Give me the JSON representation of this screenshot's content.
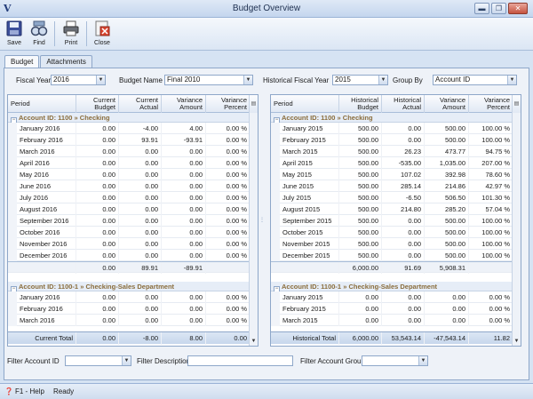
{
  "window": {
    "title": "Budget Overview",
    "app_glyph": "V"
  },
  "toolbar": {
    "save": "Save",
    "find": "Find",
    "print": "Print",
    "close": "Close"
  },
  "tabs": [
    {
      "label": "Budget"
    },
    {
      "label": "Attachments"
    }
  ],
  "filters": {
    "fiscal_year_label": "Fiscal Year",
    "fiscal_year_value": "2016",
    "budget_name_label": "Budget Name",
    "budget_name_value": "Final 2010",
    "hist_year_label": "Historical Fiscal Year",
    "hist_year_value": "2015",
    "group_by_label": "Group By",
    "group_by_value": "Account ID"
  },
  "left_grid": {
    "headers": [
      "Period",
      "Current Budget",
      "Current Actual",
      "Variance Amount",
      "Variance Percent"
    ],
    "group1": "Account ID: 1100 » Checking",
    "rows1": [
      [
        "January 2016",
        "0.00",
        "-4.00",
        "4.00",
        "0.00 %"
      ],
      [
        "February 2016",
        "0.00",
        "93.91",
        "-93.91",
        "0.00 %"
      ],
      [
        "March 2016",
        "0.00",
        "0.00",
        "0.00",
        "0.00 %"
      ],
      [
        "April 2016",
        "0.00",
        "0.00",
        "0.00",
        "0.00 %"
      ],
      [
        "May 2016",
        "0.00",
        "0.00",
        "0.00",
        "0.00 %"
      ],
      [
        "June 2016",
        "0.00",
        "0.00",
        "0.00",
        "0.00 %"
      ],
      [
        "July 2016",
        "0.00",
        "0.00",
        "0.00",
        "0.00 %"
      ],
      [
        "August 2016",
        "0.00",
        "0.00",
        "0.00",
        "0.00 %"
      ],
      [
        "September 2016",
        "0.00",
        "0.00",
        "0.00",
        "0.00 %"
      ],
      [
        "October 2016",
        "0.00",
        "0.00",
        "0.00",
        "0.00 %"
      ],
      [
        "November 2016",
        "0.00",
        "0.00",
        "0.00",
        "0.00 %"
      ],
      [
        "December 2016",
        "0.00",
        "0.00",
        "0.00",
        "0.00 %"
      ]
    ],
    "subtotal1": [
      "",
      "0.00",
      "89.91",
      "-89.91",
      ""
    ],
    "group2": "Account ID: 1100-1 » Checking-Sales Department",
    "rows2": [
      [
        "January 2016",
        "0.00",
        "0.00",
        "0.00",
        "0.00 %"
      ],
      [
        "February 2016",
        "0.00",
        "0.00",
        "0.00",
        "0.00 %"
      ],
      [
        "March 2016",
        "0.00",
        "0.00",
        "0.00",
        "0.00 %"
      ]
    ],
    "total": [
      "Current Total",
      "0.00",
      "-8.00",
      "8.00",
      "0.00"
    ]
  },
  "right_grid": {
    "headers": [
      "Period",
      "Historical Budget",
      "Historical Actual",
      "Variance Amount",
      "Variance Percent"
    ],
    "group1": "Account ID: 1100 » Checking",
    "rows1": [
      [
        "January 2015",
        "500.00",
        "0.00",
        "500.00",
        "100.00 %"
      ],
      [
        "February 2015",
        "500.00",
        "0.00",
        "500.00",
        "100.00 %"
      ],
      [
        "March 2015",
        "500.00",
        "26.23",
        "473.77",
        "94.75 %"
      ],
      [
        "April 2015",
        "500.00",
        "-535.00",
        "1,035.00",
        "207.00 %"
      ],
      [
        "May 2015",
        "500.00",
        "107.02",
        "392.98",
        "78.60 %"
      ],
      [
        "June 2015",
        "500.00",
        "285.14",
        "214.86",
        "42.97 %"
      ],
      [
        "July 2015",
        "500.00",
        "-6.50",
        "506.50",
        "101.30 %"
      ],
      [
        "August 2015",
        "500.00",
        "214.80",
        "285.20",
        "57.04 %"
      ],
      [
        "September 2015",
        "500.00",
        "0.00",
        "500.00",
        "100.00 %"
      ],
      [
        "October 2015",
        "500.00",
        "0.00",
        "500.00",
        "100.00 %"
      ],
      [
        "November 2015",
        "500.00",
        "0.00",
        "500.00",
        "100.00 %"
      ],
      [
        "December 2015",
        "500.00",
        "0.00",
        "500.00",
        "100.00 %"
      ]
    ],
    "subtotal1": [
      "",
      "6,000.00",
      "91.69",
      "5,908.31",
      ""
    ],
    "group2": "Account ID: 1100-1 » Checking-Sales Department",
    "rows2": [
      [
        "January 2015",
        "0.00",
        "0.00",
        "0.00",
        "0.00 %"
      ],
      [
        "February 2015",
        "0.00",
        "0.00",
        "0.00",
        "0.00 %"
      ],
      [
        "March 2015",
        "0.00",
        "0.00",
        "0.00",
        "0.00 %"
      ]
    ],
    "total": [
      "Historical Total",
      "6,000.00",
      "53,543.14",
      "-47,543.14",
      "11.82"
    ]
  },
  "bottom_filters": {
    "account_id_label": "Filter Account ID",
    "description_label": "Filter Description",
    "account_group_label": "Filter Account Group"
  },
  "statusbar": {
    "help": "F1 - Help",
    "status": "Ready"
  }
}
